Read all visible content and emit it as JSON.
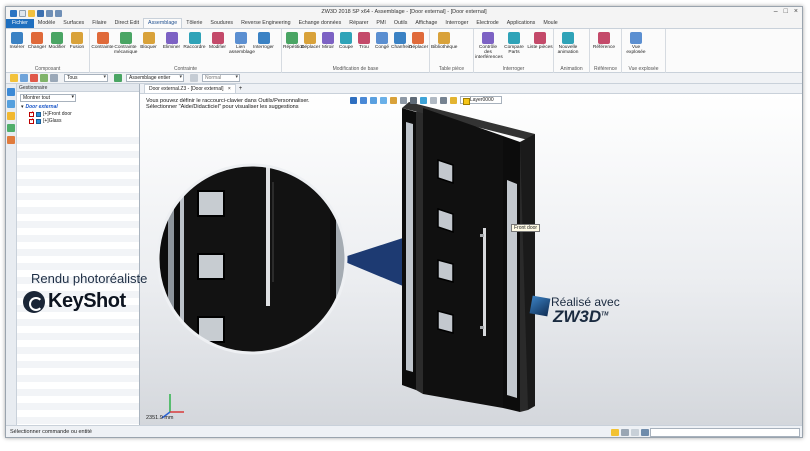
{
  "window": {
    "title": "ZW3D 2018 SP x64 - Assemblage - [Door external] - [Door external]"
  },
  "menu": {
    "tabs": [
      "Fichier",
      "Modèle",
      "Surfaces",
      "Filaire",
      "Direct Edit",
      "Assemblage",
      "Tôlerie",
      "Soudures",
      "Reverse Engineering",
      "Echange données",
      "Réparer",
      "PMI",
      "Outils",
      "Affichage",
      "Interroger",
      "Electrode",
      "Applications",
      "Moule"
    ],
    "active": "Assemblage"
  },
  "ribbon": {
    "groups": [
      {
        "name": "Composant",
        "buttons": [
          "Insérer",
          "Changer",
          "Modifier",
          "Fusion"
        ]
      },
      {
        "name": "Contrainte",
        "buttons": [
          "Contrainte",
          "Contrainte mécanique",
          "Bloquer",
          "Eliminer",
          "Raccordre",
          "Modifier",
          "Lien assemblage",
          "Interroger"
        ]
      },
      {
        "name": "Modification de base",
        "buttons": [
          "Répétition",
          "Déplacer",
          "Miroir",
          "Coupe",
          "Trou",
          "Congé",
          "Chanfrein",
          "Déplacer"
        ]
      },
      {
        "name": "Table pièce",
        "buttons": [
          "Bibliothèque"
        ]
      },
      {
        "name": "Interroger",
        "buttons": [
          "Contrôle des interférences",
          "Compare Parts",
          "Liste pièces"
        ]
      },
      {
        "name": "Animation",
        "buttons": [
          "Nouvelle animation"
        ]
      },
      {
        "name": "Référence",
        "buttons": [
          "Référence"
        ]
      },
      {
        "name": "Vue explosée",
        "buttons": [
          "Vue explosée"
        ]
      }
    ]
  },
  "toolbar": {
    "filter_value": "Tous",
    "assembly_filter": "Assemblage entier",
    "render_mode": "Normal"
  },
  "manager": {
    "header": "Gestionnaire",
    "dropdown": "Montrer tout",
    "tree": {
      "root": "Door external",
      "children": [
        "[+]Front door",
        "[+]Glass"
      ]
    }
  },
  "document_tab": {
    "label": "Door external.Z3 - [Door external]",
    "close": "×",
    "add": "+"
  },
  "viewport": {
    "hint_lines": [
      "Vous pouvez définir le raccourci-clavier dans Outils/Personnaliser.",
      "Sélectionner \"Aide/Didacticiel\" pour visualiser les suggestions"
    ],
    "layer": "Layer0000",
    "tooltip": "Front door",
    "scale_readout": "2351.9 mm"
  },
  "branding": {
    "render_label": "Rendu photoréaliste",
    "render_brand": "KeyShot",
    "made_with": "Réalisé avec",
    "made_brand": "ZW3D",
    "made_tm": "TM"
  },
  "statusbar": {
    "message": "Sélectionner commande ou entité"
  },
  "colors": {
    "accent": "#1f6fbf",
    "door": "#111111",
    "glass": "#b9bfc6",
    "handle": "#d7d9dc",
    "leader": "#1d3a72"
  }
}
